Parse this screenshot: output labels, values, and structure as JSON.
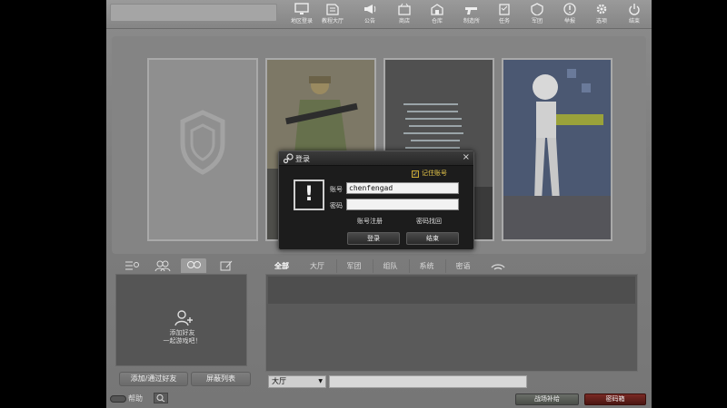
{
  "topbar": {
    "menu": [
      {
        "label": "地区登录",
        "icon": "monitor-icon"
      },
      {
        "label": "教程大厅",
        "icon": "book-icon"
      },
      {
        "label": "公告",
        "icon": "megaphone-icon"
      },
      {
        "label": "商店",
        "icon": "shop-icon"
      },
      {
        "label": "仓库",
        "icon": "warehouse-icon"
      },
      {
        "label": "制造所",
        "icon": "gun-icon"
      },
      {
        "label": "任务",
        "icon": "mission-icon"
      },
      {
        "label": "军团",
        "icon": "legion-icon"
      },
      {
        "label": "举报",
        "icon": "report-icon"
      },
      {
        "label": "选项",
        "icon": "gear-icon"
      },
      {
        "label": "结束",
        "icon": "power-icon"
      }
    ]
  },
  "friends": {
    "tab_icons": [
      "list-icon",
      "group-icon",
      "friends-icon",
      "edit-icon"
    ],
    "hint_line1": "添加好友",
    "hint_line2": "一起游戏吧！",
    "add_button": "添加/通过好友",
    "block_button": "屏蔽列表"
  },
  "chat": {
    "tabs": [
      "全部",
      "大厅",
      "军团",
      "组队",
      "系统",
      "密语"
    ],
    "channel": "大厅",
    "input_value": ""
  },
  "footer": {
    "help_label": "帮助",
    "supply_button": "战场补给",
    "code_button": "密码箱"
  },
  "dialog": {
    "title": "登录",
    "close": "×",
    "remember_label": "记住账号",
    "remember_checked": "✓",
    "warning_mark": "!",
    "account_label": "账号",
    "account_value": "chenfengad",
    "password_label": "密码",
    "password_value": "",
    "register_link": "账号注册",
    "find_link": "密码找回",
    "login_button": "登录",
    "end_button": "结束"
  },
  "colors": {
    "remember_accent": "#e8c84a",
    "code_button": "#7a2a25"
  }
}
